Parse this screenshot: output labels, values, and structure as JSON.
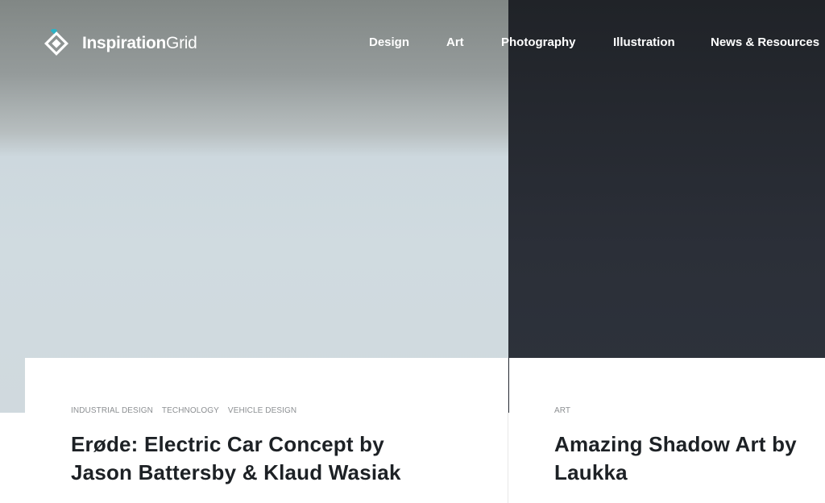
{
  "site": {
    "logo_bold": "Inspiration",
    "logo_light": "Grid"
  },
  "nav": {
    "items": [
      {
        "label": "Design"
      },
      {
        "label": "Art"
      },
      {
        "label": "Photography"
      },
      {
        "label": "Illustration"
      },
      {
        "label": "News & Resources"
      }
    ]
  },
  "posts": [
    {
      "tags": [
        "INDUSTRIAL DESIGN",
        "TECHNOLOGY",
        "VEHICLE DESIGN"
      ],
      "title_line1": "Erøde: Electric Car Concept by",
      "title_line2": "Jason Battersby & Klaud Wasiak"
    },
    {
      "tags": [
        "ART"
      ],
      "title_line1": "Amazing Shadow Art by",
      "title_line2": "Laukka"
    }
  ],
  "colors": {
    "accent": "#2bb3c6",
    "title_text": "#1d2125",
    "tag_text": "#8c8f92",
    "dark_panel": "#2b2f38"
  },
  "icons": {
    "logo": "inspirationgrid-diamond-logo-icon"
  }
}
